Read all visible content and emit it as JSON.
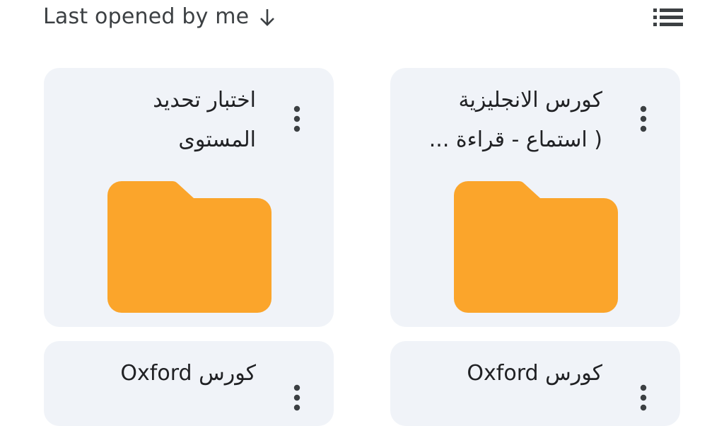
{
  "header": {
    "sort_label": "Last opened by me",
    "sort_direction_icon": "arrow-down-icon",
    "view_toggle_icon": "list-view-icon"
  },
  "colors": {
    "folder": "#fba52b",
    "card_background": "#f0f3f8",
    "text": "#202124"
  },
  "files": [
    {
      "type": "folder",
      "title_line1": "كورس الانجليزية",
      "title_line2": "( استماع - قراءة ...",
      "menu_icon": "more-vert-icon"
    },
    {
      "type": "folder",
      "title_line1": "اختبار تحديد",
      "title_line2": "المستوى",
      "menu_icon": "more-vert-icon"
    },
    {
      "type": "folder",
      "title_line1": "كورس Oxford",
      "menu_icon": "more-vert-icon"
    },
    {
      "type": "folder",
      "title_line1": "كورس Oxford",
      "menu_icon": "more-vert-icon"
    }
  ]
}
